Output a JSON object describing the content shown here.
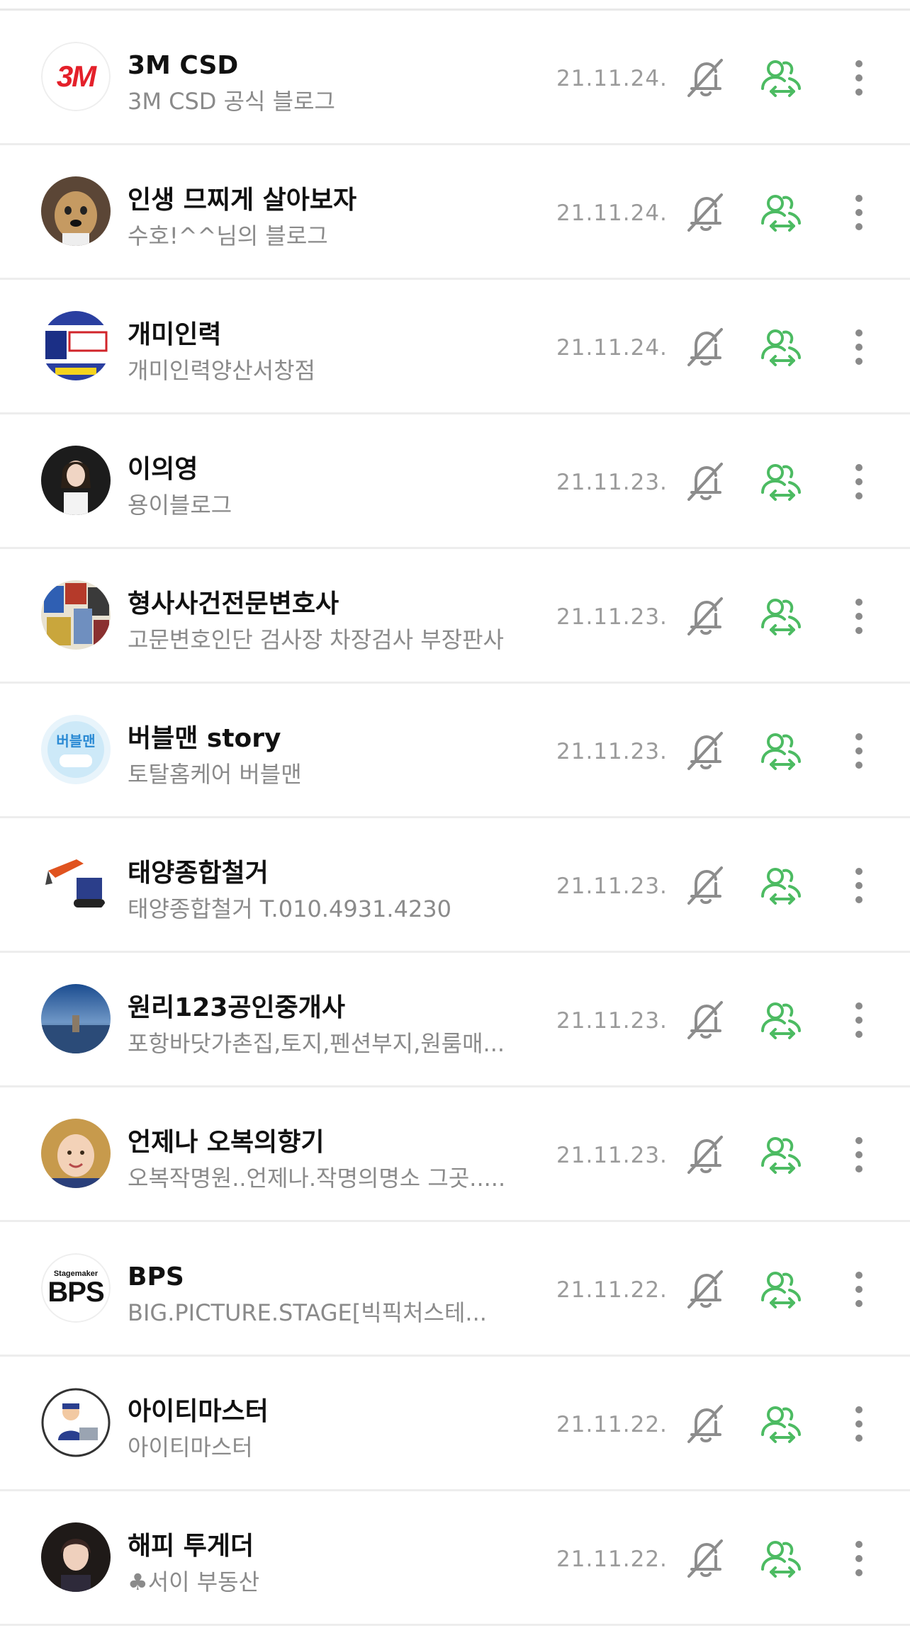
{
  "colors": {
    "accent_green": "#4cbb62",
    "icon_gray": "#8c8c8c"
  },
  "items": [
    {
      "title": "3M CSD",
      "subtitle": "3M CSD 공식 블로그",
      "date": "21.11.24.",
      "avatar": "3m-logo",
      "avatar_text": "3M"
    },
    {
      "title": "인생 므찌게 살아보자",
      "subtitle": "수호!^^님의 블로그",
      "date": "21.11.24.",
      "avatar": "dog-photo"
    },
    {
      "title": "개미인력",
      "subtitle": "개미인력양산서창점",
      "date": "21.11.24.",
      "avatar": "poster-photo"
    },
    {
      "title": "이의영",
      "subtitle": "용이블로그",
      "date": "21.11.23.",
      "avatar": "person-photo"
    },
    {
      "title": "형사사건전문변호사",
      "subtitle": "고문변호인단 검사장 차장검사 부장판사",
      "date": "21.11.23.",
      "avatar": "collage-photo"
    },
    {
      "title": "버블맨 story",
      "subtitle": "토탈홈케어 버블맨",
      "date": "21.11.23.",
      "avatar": "bubble-logo"
    },
    {
      "title": "태양종합철거",
      "subtitle": "태양종합철거 T.010.4931.4230",
      "date": "21.11.23.",
      "avatar": "excavator-photo"
    },
    {
      "title": "원리123공인중개사",
      "subtitle": "포항바닷가촌집,토지,펜션부지,원룸매...",
      "date": "21.11.23.",
      "avatar": "sea-photo"
    },
    {
      "title": "언제나 오복의향기",
      "subtitle": "오복작명원..언제나.작명의명소 그곳.....",
      "date": "21.11.23.",
      "avatar": "child-photo"
    },
    {
      "title": "BPS",
      "subtitle": "BIG.PICTURE.STAGE[빅픽처스테...",
      "date": "21.11.22.",
      "avatar": "bps-logo",
      "avatar_text": "BPS",
      "avatar_small_text": "Stagemaker"
    },
    {
      "title": "아이티마스터",
      "subtitle": "아이티마스터",
      "date": "21.11.22.",
      "avatar": "cartoon-man"
    },
    {
      "title": "해피 투게더",
      "subtitle": "♣서이 부동산",
      "date": "21.11.22.",
      "avatar": "woman-photo"
    }
  ]
}
